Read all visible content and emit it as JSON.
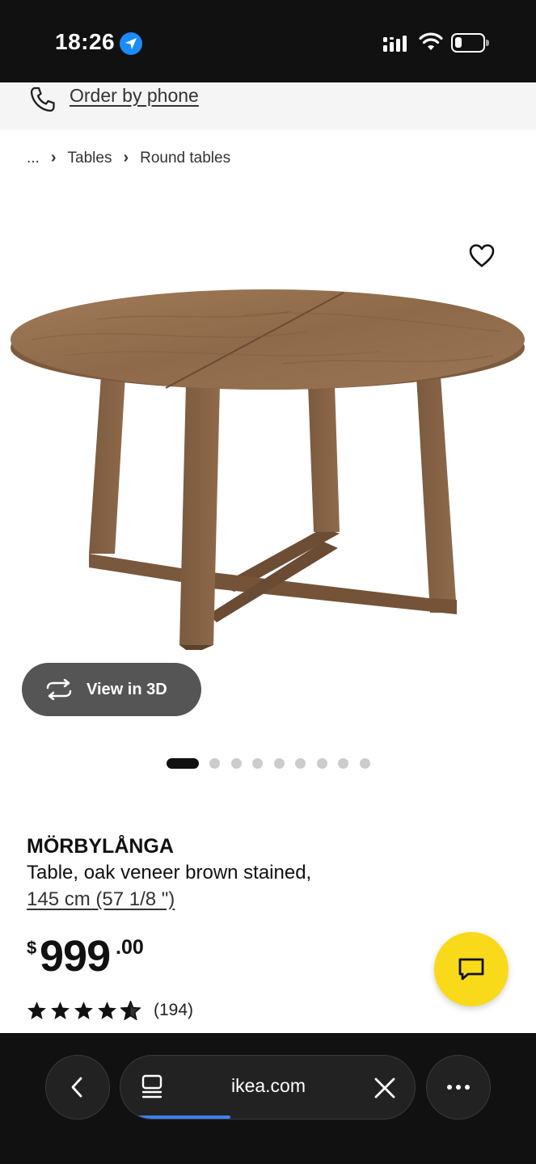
{
  "status_bar": {
    "time": "18:26"
  },
  "order_bar": {
    "link": "Order by phone"
  },
  "breadcrumb": {
    "ellipsis": "...",
    "items": [
      "Tables",
      "Round tables"
    ]
  },
  "gallery": {
    "view_3d_label": "View in 3D",
    "slide_count": 9,
    "active_slide": 1
  },
  "product": {
    "name": "MÖRBYLÅNGA",
    "description": "Table, oak veneer brown stained,",
    "size": "145 cm (57 1/8 \")"
  },
  "price": {
    "currency": "$",
    "integer": "999",
    "decimals": ".00"
  },
  "rating": {
    "stars": 4.5,
    "count": "(194)"
  },
  "browser": {
    "domain": "ikea.com",
    "load_progress": 0.32
  },
  "colors": {
    "accent_yellow": "#f9da1a",
    "progress_blue": "#3b82f6",
    "wood": "#8a6444"
  },
  "icons": [
    "location-arrow-icon",
    "signal-icon",
    "wifi-icon",
    "battery-icon",
    "phone-icon",
    "heart-icon",
    "rotate-3d-icon",
    "star-icon",
    "chat-icon",
    "back-icon",
    "tabs-icon",
    "close-icon",
    "more-icon"
  ]
}
